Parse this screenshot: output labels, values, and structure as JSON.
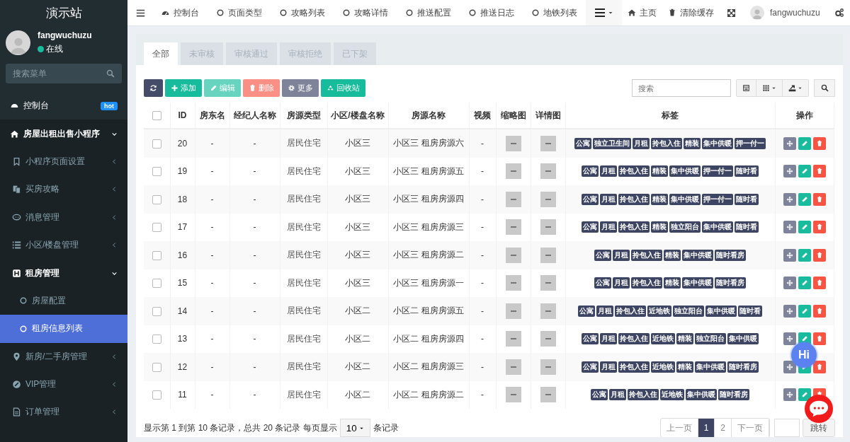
{
  "sidebar": {
    "logo": "演示站",
    "user": {
      "name": "fangwuchuzu",
      "status": "在线",
      "online": true
    },
    "search": {
      "placeholder": "搜索菜单"
    },
    "items": [
      {
        "label": "控制台",
        "badge": "hot",
        "selected": false
      },
      {
        "label": "房屋出租出售小程序",
        "expanded": true,
        "selected": false,
        "children": [
          {
            "label": "小程序页面设置",
            "expanded": false,
            "selected": false
          },
          {
            "label": "买房攻略",
            "expanded": false,
            "selected": false
          },
          {
            "label": "消息管理",
            "expanded": false,
            "selected": false
          },
          {
            "label": "小区/楼盘管理",
            "expanded": false,
            "selected": false
          },
          {
            "label": "租房管理",
            "expanded": true,
            "selected": false,
            "children": [
              {
                "label": "房屋配置",
                "selected": false
              },
              {
                "label": "租房信息列表",
                "selected": true
              }
            ]
          },
          {
            "label": "新房/二手房管理",
            "expanded": false,
            "selected": false
          },
          {
            "label": "VIP管理",
            "expanded": false,
            "selected": false
          },
          {
            "label": "订单管理",
            "expanded": false,
            "selected": false
          }
        ]
      }
    ]
  },
  "topbar": {
    "tabs": [
      {
        "label": "控制台",
        "selected": false
      },
      {
        "label": "页面类型",
        "selected": false
      },
      {
        "label": "攻略列表",
        "selected": false
      },
      {
        "label": "攻略详情",
        "selected": false
      },
      {
        "label": "推送配置",
        "selected": false
      },
      {
        "label": "推送日志",
        "selected": false
      },
      {
        "label": "地铁列表",
        "selected": false
      }
    ],
    "links": [
      {
        "label": "主页"
      },
      {
        "label": "清除缓存"
      }
    ],
    "user": "fangwuchuzu"
  },
  "panel": {
    "tabs": [
      {
        "label": "全部",
        "selected": true
      },
      {
        "label": "未审核",
        "selected": false
      },
      {
        "label": "审核通过",
        "selected": false
      },
      {
        "label": "审核拒绝",
        "selected": false
      },
      {
        "label": "已下架",
        "selected": false
      }
    ],
    "buttons": [
      {
        "kind": "dark",
        "disabled": false
      },
      {
        "kind": "success",
        "label": "添加",
        "disabled": false
      },
      {
        "kind": "success",
        "label": "编辑",
        "disabled": true
      },
      {
        "kind": "danger",
        "label": "删除",
        "disabled": true
      },
      {
        "kind": "info",
        "label": "更多",
        "disabled": false
      },
      {
        "kind": "success",
        "label": "回收站",
        "disabled": false
      }
    ],
    "search": {
      "placeholder": "搜索"
    }
  },
  "table": {
    "all_checked": false,
    "columns": [
      "ID",
      "房东名",
      "经纪人名称",
      "房源类型",
      "小区/楼盘名称",
      "房源名称",
      "视频",
      "缩略图",
      "详情图",
      "标签",
      "操作"
    ],
    "rows": [
      {
        "checked": false,
        "id": "20",
        "landlord": "-",
        "agent": "-",
        "type": "居民住宅",
        "community": "小区三",
        "name": "小区三 租房房源六",
        "video": "-",
        "tags": [
          "公寓",
          "独立卫生间",
          "月租",
          "拎包入住",
          "精装",
          "集中供暖",
          "押一付一"
        ]
      },
      {
        "checked": false,
        "id": "19",
        "landlord": "-",
        "agent": "-",
        "type": "居民住宅",
        "community": "小区三",
        "name": "小区三 租房房源五",
        "video": "-",
        "tags": [
          "公寓",
          "月租",
          "拎包入住",
          "精装",
          "集中供暖",
          "押一付一",
          "随时看"
        ]
      },
      {
        "checked": false,
        "id": "18",
        "landlord": "-",
        "agent": "-",
        "type": "居民住宅",
        "community": "小区三",
        "name": "小区三 租房房源四",
        "video": "-",
        "tags": [
          "公寓",
          "月租",
          "拎包入住",
          "精装",
          "集中供暖",
          "押一付一",
          "随时看"
        ]
      },
      {
        "checked": false,
        "id": "17",
        "landlord": "-",
        "agent": "-",
        "type": "居民住宅",
        "community": "小区三",
        "name": "小区三 租房房源三",
        "video": "-",
        "tags": [
          "公寓",
          "月租",
          "拎包入住",
          "精装",
          "独立阳台",
          "集中供暖",
          "随时看"
        ]
      },
      {
        "checked": false,
        "id": "16",
        "landlord": "-",
        "agent": "-",
        "type": "居民住宅",
        "community": "小区三",
        "name": "小区三 租房房源二",
        "video": "-",
        "tags": [
          "公寓",
          "月租",
          "拎包入住",
          "精装",
          "集中供暖",
          "随时看房"
        ]
      },
      {
        "checked": false,
        "id": "15",
        "landlord": "-",
        "agent": "-",
        "type": "居民住宅",
        "community": "小区三",
        "name": "小区三 租房房源一",
        "video": "-",
        "tags": [
          "公寓",
          "月租",
          "拎包入住",
          "精装",
          "集中供暖",
          "随时看房"
        ]
      },
      {
        "checked": false,
        "id": "14",
        "landlord": "-",
        "agent": "-",
        "type": "居民住宅",
        "community": "小区二",
        "name": "小区二 租房房源五",
        "video": "-",
        "tags": [
          "公寓",
          "月租",
          "拎包入住",
          "近地铁",
          "独立阳台",
          "集中供暖",
          "随时看"
        ]
      },
      {
        "checked": false,
        "id": "13",
        "landlord": "-",
        "agent": "-",
        "type": "居民住宅",
        "community": "小区二",
        "name": "小区二 租房房源四",
        "video": "-",
        "tags": [
          "公寓",
          "月租",
          "拎包入住",
          "近地铁",
          "精装",
          "独立阳台",
          "集中供暖"
        ]
      },
      {
        "checked": false,
        "id": "12",
        "landlord": "-",
        "agent": "-",
        "type": "居民住宅",
        "community": "小区二",
        "name": "小区二 租房房源三",
        "video": "-",
        "tags": [
          "公寓",
          "月租",
          "拎包入住",
          "近地铁",
          "精装",
          "集中供暖",
          "随时看房"
        ]
      },
      {
        "checked": false,
        "id": "11",
        "landlord": "-",
        "agent": "-",
        "type": "居民住宅",
        "community": "小区二",
        "name": "小区二 租房房源二",
        "video": "-",
        "tags": [
          "公寓",
          "月租",
          "拎包入住",
          "近地铁",
          "集中供暖",
          "随时看房"
        ]
      }
    ]
  },
  "pagination": {
    "summary": "显示第 1 到第 10 条记录，总共 20 条记录 每页显示",
    "page_size": "10",
    "page_size_suffix": "条记录",
    "pages": [
      {
        "label": "上一页",
        "selected": false
      },
      {
        "label": "1",
        "selected": true
      },
      {
        "label": "2",
        "selected": false
      },
      {
        "label": "下一页",
        "selected": false
      }
    ],
    "go": "跳转"
  },
  "chat_widget": {
    "label": "Hi"
  }
}
